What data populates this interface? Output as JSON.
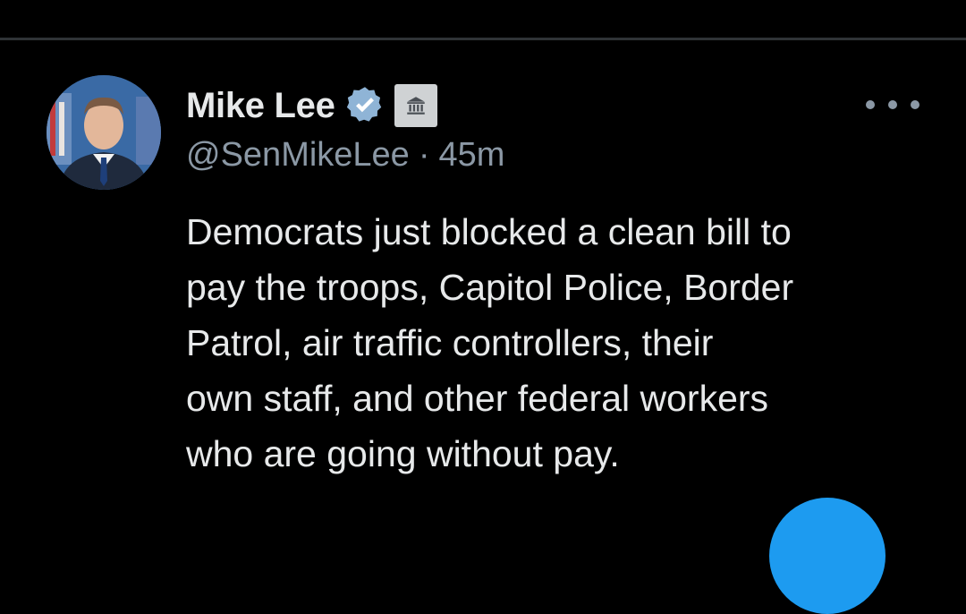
{
  "tweet": {
    "author": {
      "display_name": "Mike Lee",
      "handle": "@SenMikeLee",
      "verified_icon": "verified-badge-icon",
      "affiliation_icon": "government-building-icon"
    },
    "separator": "·",
    "timestamp": "45m",
    "text_lines": [
      "Democrats just blocked a clean bill to",
      "pay the troops, Capitol Police, Border",
      "Patrol, air traffic controllers, their",
      "own staff, and other federal workers",
      "who are going without pay."
    ]
  },
  "actions": {
    "more_icon": "more-options-icon",
    "compose_icon": "compose-fab"
  },
  "colors": {
    "background": "#000000",
    "text_primary": "#e7e9ea",
    "text_secondary": "#8b98a5",
    "divider": "#2f3336",
    "verified_blue": "#8fb4d6",
    "gov_badge": "#cfd2d4",
    "accent": "#1d9bf0"
  }
}
